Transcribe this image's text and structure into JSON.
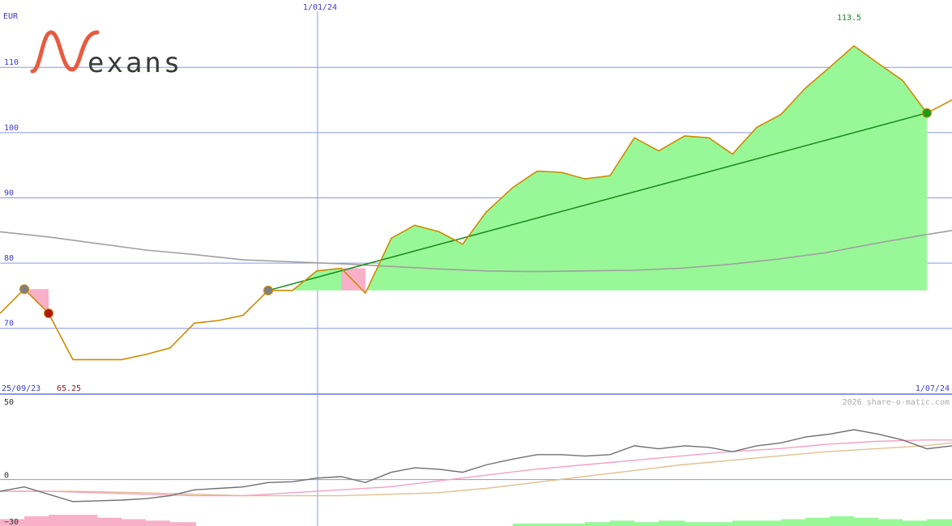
{
  "colors": {
    "price": "#d08a00",
    "gain_fill": "#98f898",
    "loss_fill": "#f8b0c8",
    "trend": "#1a8c1a",
    "ma_long": "#a0a0a0",
    "grid": "#8c96e6",
    "axis_text": "#3c3ccc",
    "osc_grey": "#707070",
    "osc_pink": "#f4a0c0",
    "osc_tan": "#e0c090",
    "logo_red": "#e85a40",
    "logo_text": "#3a3a3a",
    "high_text": "#1a8c1a",
    "low_text": "#8c1a1a",
    "watermark": "#aaaaaa"
  },
  "logo": {
    "word": "exans"
  },
  "watermark": "2026 share-o-matic.com",
  "chart_data": [
    {
      "type": "line",
      "unit_label": "EUR",
      "ylim": [
        65.25,
        113.5
      ],
      "y_ticks": [
        70,
        80,
        90,
        100,
        110
      ],
      "x_labels": {
        "start": "25/09/23",
        "mid": "1/01/24",
        "end": "1/07/24"
      },
      "high_label": "113.5",
      "low_label": "65.25",
      "price_series": [
        [
          0,
          72.3
        ],
        [
          30,
          76
        ],
        [
          60,
          72.3
        ],
        [
          90,
          65.2
        ],
        [
          120,
          65.2
        ],
        [
          150,
          65.2
        ],
        [
          180,
          66
        ],
        [
          210,
          67
        ],
        [
          240,
          70.8
        ],
        [
          270,
          71.2
        ],
        [
          300,
          72
        ],
        [
          331,
          75.8
        ],
        [
          361,
          75.8
        ],
        [
          391,
          78.8
        ],
        [
          421,
          79.2
        ],
        [
          451,
          75.4
        ],
        [
          483,
          83.8
        ],
        [
          512,
          85.8
        ],
        [
          542,
          84.8
        ],
        [
          571,
          82.9
        ],
        [
          600,
          87.8
        ],
        [
          633,
          91.6
        ],
        [
          663,
          94.1
        ],
        [
          693,
          93.9
        ],
        [
          722,
          92.9
        ],
        [
          753,
          93.4
        ],
        [
          783,
          99.2
        ],
        [
          813,
          97.2
        ],
        [
          845,
          99.5
        ],
        [
          875,
          99.2
        ],
        [
          904,
          96.7
        ],
        [
          934,
          100.8
        ],
        [
          964,
          102.8
        ],
        [
          994,
          106.8
        ],
        [
          1024,
          110
        ],
        [
          1054,
          113.3
        ],
        [
          1084,
          110.6
        ],
        [
          1114,
          108
        ],
        [
          1144,
          103
        ],
        [
          1175,
          105
        ]
      ],
      "gain_baseline": 75.8,
      "gain_region": [
        331,
        1144
      ],
      "loss_regions": [
        [
          30,
          60
        ],
        [
          421,
          451
        ]
      ],
      "loss_baselines": [
        76,
        79.2
      ],
      "trend_line": {
        "from": [
          331,
          75.8
        ],
        "to": [
          1144,
          103
        ]
      },
      "ma_long": [
        [
          0,
          84.8
        ],
        [
          60,
          84
        ],
        [
          120,
          83
        ],
        [
          180,
          82
        ],
        [
          240,
          81.3
        ],
        [
          300,
          80.5
        ],
        [
          360,
          80.2
        ],
        [
          420,
          79.9
        ],
        [
          480,
          79.5
        ],
        [
          540,
          79.1
        ],
        [
          600,
          78.8
        ],
        [
          660,
          78.7
        ],
        [
          720,
          78.8
        ],
        [
          780,
          78.9
        ],
        [
          840,
          79.2
        ],
        [
          900,
          79.8
        ],
        [
          960,
          80.6
        ],
        [
          1020,
          81.6
        ],
        [
          1080,
          83
        ],
        [
          1140,
          84.3
        ],
        [
          1175,
          85
        ]
      ],
      "markers": [
        {
          "x": 30,
          "y": 76,
          "color": "#808080",
          "kind": "pivot"
        },
        {
          "x": 60,
          "y": 72.3,
          "color": "#b01818",
          "kind": "sell"
        },
        {
          "x": 331,
          "y": 75.8,
          "color": "#808080",
          "kind": "pivot"
        },
        {
          "x": 1144,
          "y": 103,
          "color": "#1a9c1a",
          "kind": "buy"
        }
      ]
    },
    {
      "type": "line",
      "ylim": [
        -30,
        50
      ],
      "y_ticks": [
        -30,
        0,
        50
      ],
      "series_grey": [
        [
          0,
          -8
        ],
        [
          30,
          -5
        ],
        [
          60,
          -10
        ],
        [
          90,
          -15
        ],
        [
          150,
          -14
        ],
        [
          180,
          -13
        ],
        [
          210,
          -11
        ],
        [
          240,
          -7
        ],
        [
          270,
          -6
        ],
        [
          300,
          -5
        ],
        [
          331,
          -2
        ],
        [
          361,
          -1.5
        ],
        [
          391,
          1
        ],
        [
          421,
          2
        ],
        [
          451,
          -2
        ],
        [
          483,
          5
        ],
        [
          512,
          8
        ],
        [
          542,
          7
        ],
        [
          571,
          5
        ],
        [
          600,
          10
        ],
        [
          633,
          14
        ],
        [
          663,
          17
        ],
        [
          693,
          17
        ],
        [
          722,
          16
        ],
        [
          753,
          17
        ],
        [
          783,
          23
        ],
        [
          813,
          21
        ],
        [
          845,
          23
        ],
        [
          875,
          22
        ],
        [
          904,
          19
        ],
        [
          934,
          23
        ],
        [
          964,
          25
        ],
        [
          994,
          29
        ],
        [
          1024,
          31
        ],
        [
          1054,
          34
        ],
        [
          1084,
          31
        ],
        [
          1114,
          27
        ],
        [
          1144,
          21
        ],
        [
          1175,
          23
        ]
      ],
      "series_pink": [
        [
          0,
          -8
        ],
        [
          60,
          -8
        ],
        [
          120,
          -9
        ],
        [
          180,
          -10
        ],
        [
          240,
          -11
        ],
        [
          300,
          -11
        ],
        [
          360,
          -9
        ],
        [
          420,
          -7
        ],
        [
          480,
          -5
        ],
        [
          540,
          -1
        ],
        [
          600,
          3
        ],
        [
          660,
          7
        ],
        [
          720,
          10
        ],
        [
          780,
          13
        ],
        [
          840,
          16
        ],
        [
          900,
          19
        ],
        [
          960,
          21
        ],
        [
          1020,
          24
        ],
        [
          1080,
          26
        ],
        [
          1140,
          27
        ],
        [
          1175,
          27
        ]
      ],
      "series_tan": [
        [
          0,
          -8
        ],
        [
          90,
          -8
        ],
        [
          180,
          -9
        ],
        [
          240,
          -10
        ],
        [
          300,
          -11
        ],
        [
          360,
          -11
        ],
        [
          420,
          -11
        ],
        [
          480,
          -10
        ],
        [
          540,
          -9
        ],
        [
          600,
          -6
        ],
        [
          660,
          -2
        ],
        [
          720,
          2
        ],
        [
          780,
          6
        ],
        [
          840,
          10
        ],
        [
          900,
          13
        ],
        [
          960,
          16
        ],
        [
          1020,
          19
        ],
        [
          1080,
          21
        ],
        [
          1140,
          23
        ],
        [
          1175,
          25
        ]
      ],
      "bars": [
        {
          "x0": 0,
          "x1": 30,
          "v": -27,
          "sign": "neg"
        },
        {
          "x0": 30,
          "x1": 60,
          "v": -25,
          "sign": "neg"
        },
        {
          "x0": 60,
          "x1": 90,
          "v": -24,
          "sign": "neg"
        },
        {
          "x0": 90,
          "x1": 120,
          "v": -24,
          "sign": "neg"
        },
        {
          "x0": 120,
          "x1": 150,
          "v": -26,
          "sign": "neg"
        },
        {
          "x0": 150,
          "x1": 180,
          "v": -27,
          "sign": "neg"
        },
        {
          "x0": 180,
          "x1": 210,
          "v": -28,
          "sign": "neg"
        },
        {
          "x0": 210,
          "x1": 242,
          "v": -29,
          "sign": "neg"
        },
        {
          "x0": 633,
          "x1": 663,
          "v": -30,
          "sign": "pos"
        },
        {
          "x0": 663,
          "x1": 693,
          "v": -30,
          "sign": "pos"
        },
        {
          "x0": 693,
          "x1": 722,
          "v": -30,
          "sign": "pos"
        },
        {
          "x0": 722,
          "x1": 753,
          "v": -29,
          "sign": "pos"
        },
        {
          "x0": 753,
          "x1": 783,
          "v": -28,
          "sign": "pos"
        },
        {
          "x0": 783,
          "x1": 813,
          "v": -29,
          "sign": "pos"
        },
        {
          "x0": 813,
          "x1": 845,
          "v": -28,
          "sign": "pos"
        },
        {
          "x0": 845,
          "x1": 875,
          "v": -29,
          "sign": "pos"
        },
        {
          "x0": 875,
          "x1": 904,
          "v": -29,
          "sign": "pos"
        },
        {
          "x0": 904,
          "x1": 934,
          "v": -28,
          "sign": "pos"
        },
        {
          "x0": 934,
          "x1": 964,
          "v": -28,
          "sign": "pos"
        },
        {
          "x0": 964,
          "x1": 994,
          "v": -27,
          "sign": "pos"
        },
        {
          "x0": 994,
          "x1": 1024,
          "v": -26,
          "sign": "pos"
        },
        {
          "x0": 1024,
          "x1": 1054,
          "v": -25,
          "sign": "pos"
        },
        {
          "x0": 1054,
          "x1": 1084,
          "v": -26,
          "sign": "pos"
        },
        {
          "x0": 1084,
          "x1": 1114,
          "v": -27,
          "sign": "pos"
        },
        {
          "x0": 1114,
          "x1": 1144,
          "v": -28,
          "sign": "pos"
        },
        {
          "x0": 1144,
          "x1": 1175,
          "v": -27,
          "sign": "pos"
        }
      ]
    }
  ]
}
